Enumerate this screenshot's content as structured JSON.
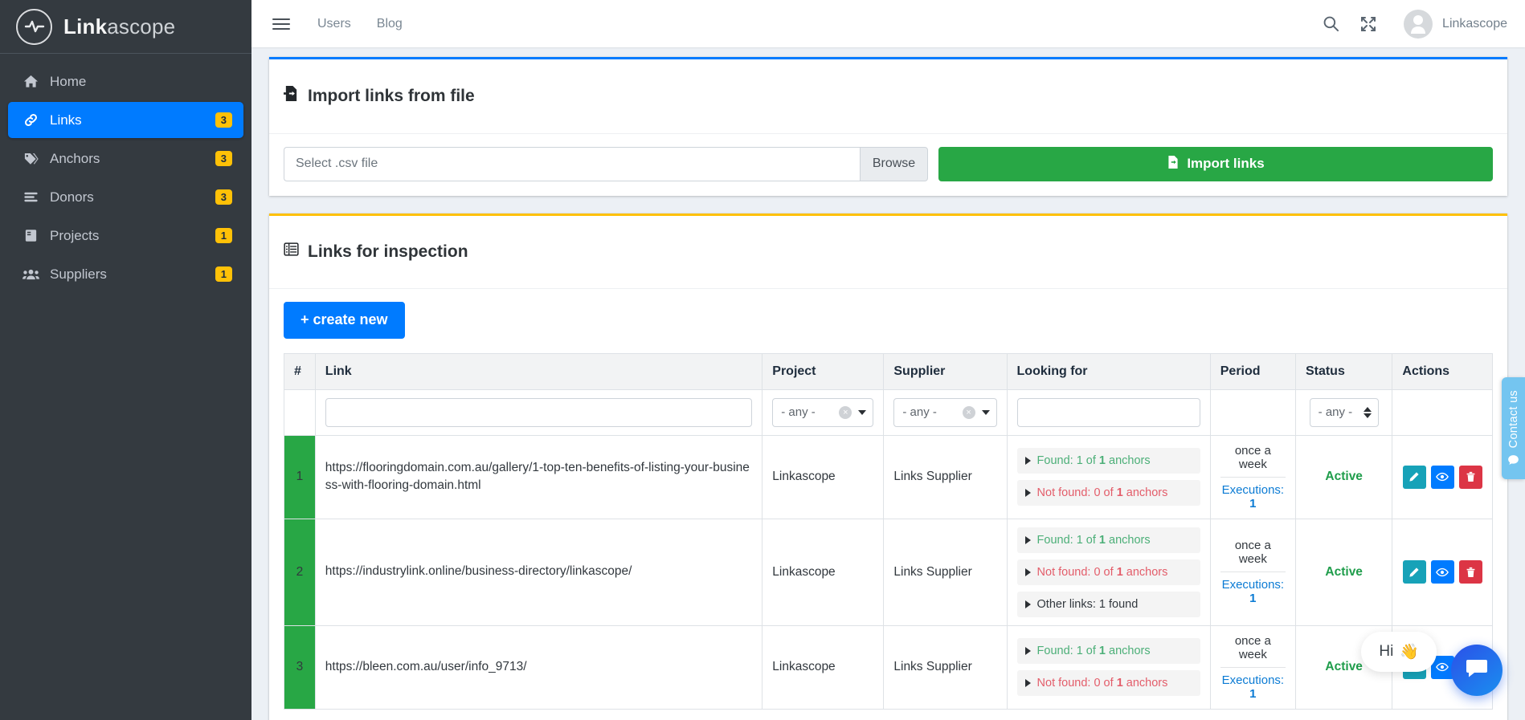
{
  "sidebar": {
    "brand": {
      "bold": "Link",
      "light": "ascope"
    },
    "items": [
      {
        "label": "Home",
        "icon": "home-icon",
        "badge": "",
        "active": false
      },
      {
        "label": "Links",
        "icon": "link-icon",
        "badge": "3",
        "active": true
      },
      {
        "label": "Anchors",
        "icon": "tag-icon",
        "badge": "3",
        "active": false
      },
      {
        "label": "Donors",
        "icon": "bars-icon",
        "badge": "3",
        "active": false
      },
      {
        "label": "Projects",
        "icon": "book-icon",
        "badge": "1",
        "active": false
      },
      {
        "label": "Suppliers",
        "icon": "users-icon",
        "badge": "1",
        "active": false
      }
    ]
  },
  "topbar": {
    "menu_icon": "hamburger-icon",
    "links": [
      "Users",
      "Blog"
    ],
    "search_icon": "search-icon",
    "fullscreen_icon": "expand-arrows-icon",
    "user_name": "Linkascope",
    "avatar_icon": "user-avatar-icon"
  },
  "import_card": {
    "title": "Import links from file",
    "title_icon": "file-import-icon",
    "file_placeholder": "Select .csv file",
    "browse_label": "Browse",
    "import_label": "Import links",
    "import_icon": "file-import-icon",
    "accent": "#007bff"
  },
  "links_card": {
    "title": "Links for inspection",
    "title_icon": "table-list-icon",
    "create_label": "+ create new",
    "accent": "#ffc107",
    "columns": [
      "#",
      "Link",
      "Project",
      "Supplier",
      "Looking for",
      "Period",
      "Status",
      "Actions"
    ],
    "filters": {
      "link": "",
      "project": "- any -",
      "supplier": "- any -",
      "looking_for": "",
      "status": "- any -"
    },
    "rows": [
      {
        "index": "1",
        "link": "https://flooringdomain.com.au/gallery/1-top-ten-benefits-of-listing-your-business-with-flooring-domain.html",
        "project": "Linkascope",
        "supplier": "Links Supplier",
        "looking_for": [
          {
            "kind": "found",
            "prefix": "Found: 1 of ",
            "count": "1",
            "suffix": " anchors"
          },
          {
            "kind": "notfound",
            "prefix": "Not found: 0 of ",
            "count": "1",
            "suffix": " anchors"
          }
        ],
        "period": "once a week",
        "executions_label": "Executions: ",
        "executions": "1",
        "status": "Active",
        "actions": [
          "edit-icon",
          "view-icon",
          "delete-icon"
        ]
      },
      {
        "index": "2",
        "link": "https://industrylink.online/business-directory/linkascope/",
        "project": "Linkascope",
        "supplier": "Links Supplier",
        "looking_for": [
          {
            "kind": "found",
            "prefix": "Found: 1 of ",
            "count": "1",
            "suffix": " anchors"
          },
          {
            "kind": "notfound",
            "prefix": "Not found: 0 of ",
            "count": "1",
            "suffix": " anchors"
          },
          {
            "kind": "other",
            "prefix": "Other links: 1 found",
            "count": "",
            "suffix": ""
          }
        ],
        "period": "once a week",
        "executions_label": "Executions: ",
        "executions": "1",
        "status": "Active",
        "actions": [
          "edit-icon",
          "view-icon",
          "delete-icon"
        ]
      },
      {
        "index": "3",
        "link": "https://bleen.com.au/user/info_9713/",
        "project": "Linkascope",
        "supplier": "Links Supplier",
        "looking_for": [
          {
            "kind": "found",
            "prefix": "Found: 1 of ",
            "count": "1",
            "suffix": " anchors"
          },
          {
            "kind": "notfound",
            "prefix": "Not found: 0 of ",
            "count": "1",
            "suffix": " anchors"
          }
        ],
        "period": "once a week",
        "executions_label": "Executions: ",
        "executions": "1",
        "status": "Active",
        "actions": [
          "edit-icon",
          "view-icon",
          "delete-icon"
        ]
      }
    ]
  },
  "chat": {
    "greeting": "Hi",
    "greeting_emoji": "👋",
    "launcher_icon": "chat-bubble-icon",
    "contact_tab": "Contact us",
    "contact_icon": "chat-bubble-icon"
  }
}
